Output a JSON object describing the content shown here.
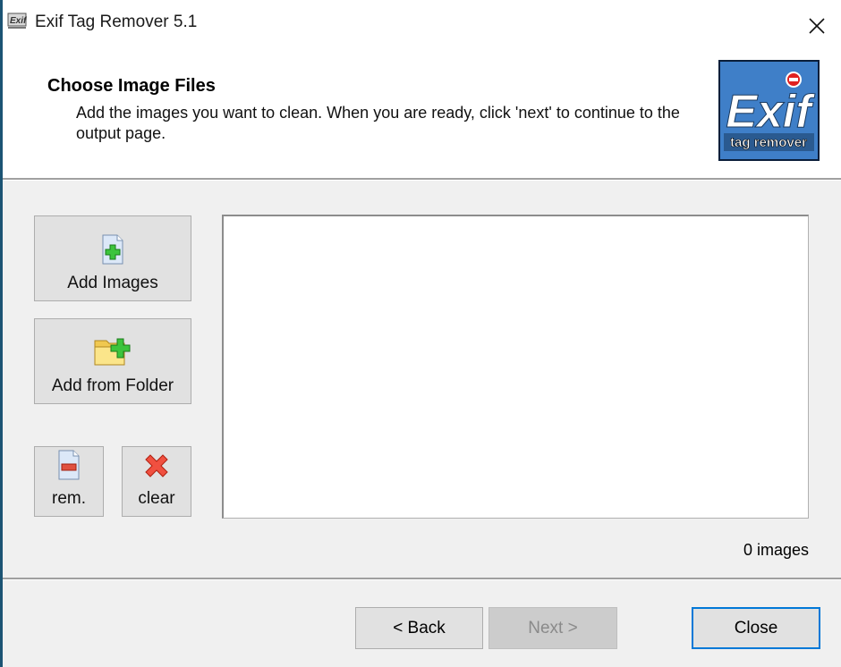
{
  "window": {
    "title": "Exif Tag Remover 5.1",
    "app_icon": "exif-app-icon",
    "close_icon": "close-icon"
  },
  "header": {
    "title": "Choose Image Files",
    "description": "Add the images you want to clean. When you are ready, click 'next' to continue to the output page.",
    "logo": {
      "main_text": "Exif",
      "sub_text": "tag remover",
      "background": "#3f7fc8"
    }
  },
  "sidebar": {
    "add_images": {
      "label": "Add Images",
      "icon": "add-file-icon"
    },
    "add_folder": {
      "label": "Add from Folder",
      "icon": "add-folder-icon"
    },
    "remove": {
      "label": "rem.",
      "icon": "remove-file-icon"
    },
    "clear": {
      "label": "clear",
      "icon": "clear-x-icon"
    }
  },
  "file_list": {
    "items": [],
    "count_label": "0 images"
  },
  "footer": {
    "back_label": "< Back",
    "next_label": "Next >",
    "next_enabled": false,
    "close_label": "Close"
  },
  "colors": {
    "accent": "#0078d7",
    "window_edge": "#1c5474",
    "button_face": "#e1e1e1"
  }
}
